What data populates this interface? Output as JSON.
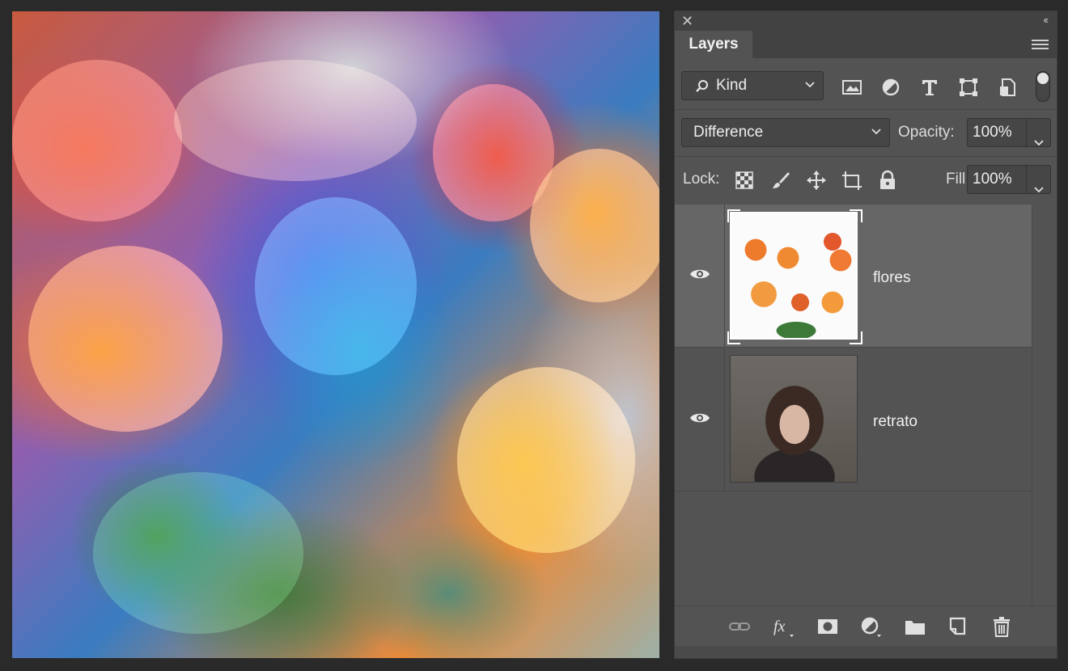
{
  "canvas": {
    "image_layers": [
      "flores",
      "retrato"
    ]
  },
  "panel": {
    "tab_label": "Layers",
    "filter": {
      "kind_label": "Kind",
      "filter_icons": [
        "image-filter-icon",
        "adjustment-filter-icon",
        "type-filter-icon",
        "shape-filter-icon",
        "smart-object-filter-icon"
      ]
    },
    "blend_mode": "Difference",
    "opacity_label": "Opacity:",
    "opacity_value": "100%",
    "lock_label": "Lock:",
    "fill_label": "Fill:",
    "fill_value": "100%",
    "layers": [
      {
        "name": "flores",
        "visible": true,
        "selected": true
      },
      {
        "name": "retrato",
        "visible": true,
        "selected": false
      }
    ],
    "bottom_icons": [
      "link-layers-icon",
      "fx-icon",
      "add-mask-icon",
      "new-adjustment-icon",
      "new-group-icon",
      "new-layer-icon",
      "delete-layer-icon"
    ]
  },
  "colors": {
    "panel_bg": "#535353",
    "selected_row": "#666666",
    "app_bg": "#2a2a2a"
  }
}
